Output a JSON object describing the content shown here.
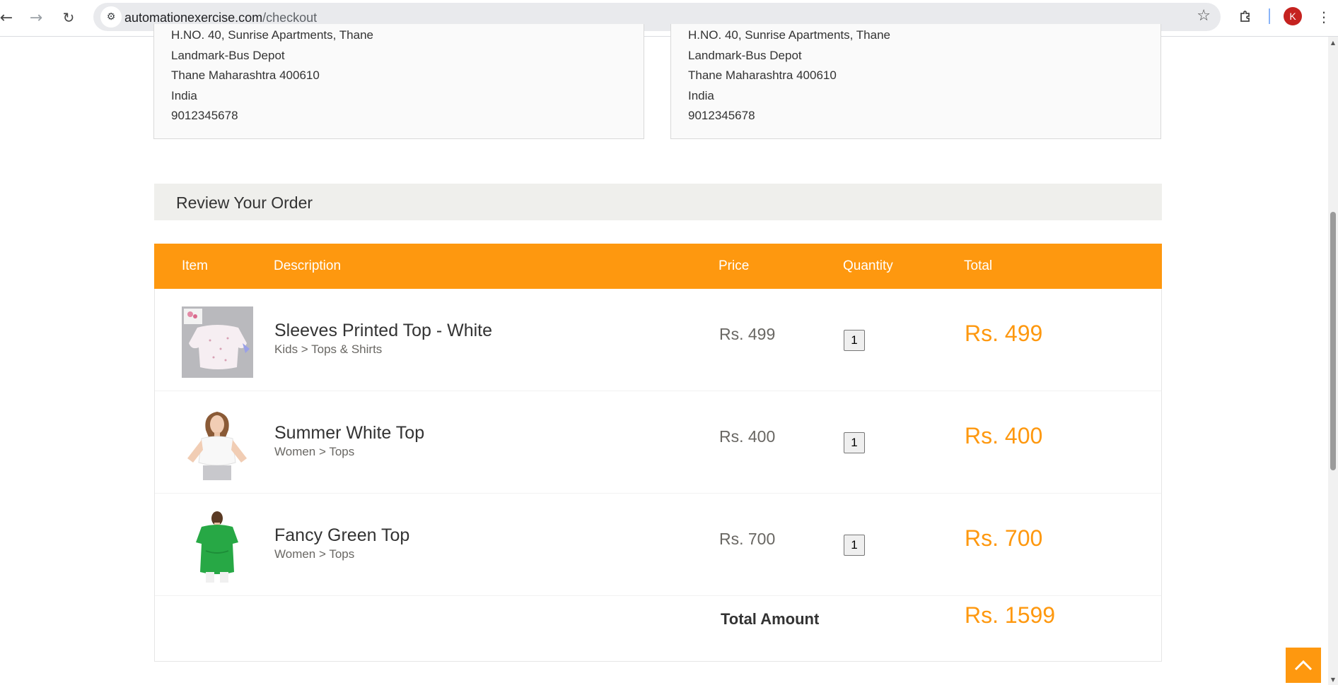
{
  "browser": {
    "url_host": "automationexercise.com",
    "url_path": "/checkout",
    "avatar_initial": "K"
  },
  "addresses": {
    "delivery": {
      "lines": [
        "H.NO. 40, Sunrise Apartments, Thane",
        "Landmark-Bus Depot",
        "Thane Maharashtra 400610",
        "India",
        "9012345678"
      ]
    },
    "billing": {
      "lines": [
        "H.NO. 40, Sunrise Apartments, Thane",
        "Landmark-Bus Depot",
        "Thane Maharashtra 400610",
        "India",
        "9012345678"
      ]
    }
  },
  "review": {
    "heading": "Review Your Order",
    "columns": {
      "item": "Item",
      "description": "Description",
      "price": "Price",
      "quantity": "Quantity",
      "total": "Total"
    },
    "rows": [
      {
        "name": "Sleeves Printed Top - White",
        "category": "Kids > Tops & Shirts",
        "price": "Rs. 499",
        "quantity": "1",
        "total": "Rs. 499"
      },
      {
        "name": "Summer White Top",
        "category": "Women > Tops",
        "price": "Rs. 400",
        "quantity": "1",
        "total": "Rs. 400"
      },
      {
        "name": "Fancy Green Top",
        "category": "Women > Tops",
        "price": "Rs. 700",
        "quantity": "1",
        "total": "Rs. 700"
      }
    ],
    "total_label": "Total Amount",
    "total_value": "Rs. 1599"
  },
  "colors": {
    "accent": "#fe980f",
    "heading_bg": "#efefec"
  }
}
